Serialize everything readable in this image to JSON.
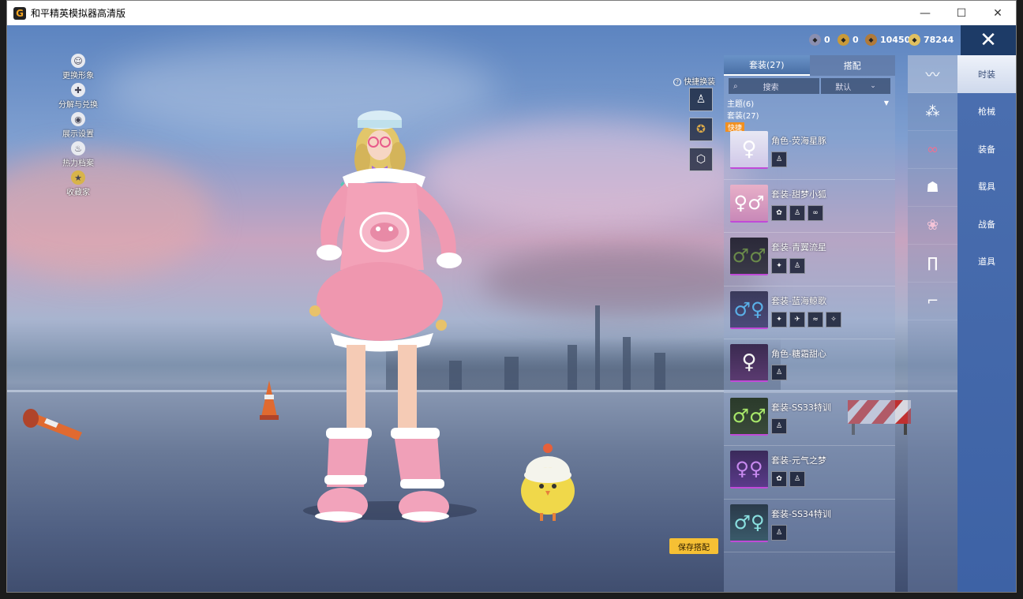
{
  "window": {
    "title": "和平精英模拟器高清版",
    "icon_letter": "G",
    "controls": {
      "minimize": "—",
      "maximize": "☐",
      "close": "✕"
    }
  },
  "left_menu": [
    {
      "label": "更换形象",
      "icon": "avatar-icon"
    },
    {
      "label": "分解与兑换",
      "icon": "puzzle-icon"
    },
    {
      "label": "展示设置",
      "icon": "eye-icon"
    },
    {
      "label": "热力档案",
      "icon": "flame-icon"
    },
    {
      "label": "收藏家",
      "icon": "collector-badge-icon"
    }
  ],
  "currencies": [
    {
      "value": "0",
      "color": "#8a8fb0"
    },
    {
      "value": "0",
      "color": "#c89a3a"
    },
    {
      "value": "10450",
      "color": "#b07a3a"
    },
    {
      "value": "78244",
      "color": "#e0c060"
    }
  ],
  "exit_glyph": "✕",
  "quick_change_label": "快捷换装",
  "quick_help_glyph": "?",
  "save_button": "保存搭配",
  "panel": {
    "tabs": [
      {
        "label": "套装(27)",
        "active": true
      },
      {
        "label": "搭配",
        "active": false
      }
    ],
    "search_label": "搜索",
    "sort_label": "默认",
    "theme_section": "主题(6)",
    "suit_section": "套装(27)",
    "quick_badge": "快捷",
    "items": [
      {
        "name": "角色-荧海星豚",
        "subs": 1
      },
      {
        "name": "套装-甜梦小狐",
        "subs": 3
      },
      {
        "name": "套装-青翼流星",
        "subs": 2
      },
      {
        "name": "套装-蓝海鲸歌",
        "subs": 4
      },
      {
        "name": "角色-糖霜甜心",
        "subs": 1
      },
      {
        "name": "套装-SS33特训",
        "subs": 1
      },
      {
        "name": "套装-元气之梦",
        "subs": 2
      },
      {
        "name": "套装-SS34特训",
        "subs": 1
      }
    ]
  },
  "side_icons": [
    "fashion-icon",
    "gun-skin-icon",
    "equipment-icon",
    "helmet-icon",
    "vehicle-icon",
    "pants-icon",
    "shoes-icon"
  ],
  "categories": [
    {
      "label": "时装",
      "active": true
    },
    {
      "label": "枪械",
      "active": false
    },
    {
      "label": "装备",
      "active": false
    },
    {
      "label": "载具",
      "active": false
    },
    {
      "label": "战备",
      "active": false
    },
    {
      "label": "道具",
      "active": false
    }
  ]
}
